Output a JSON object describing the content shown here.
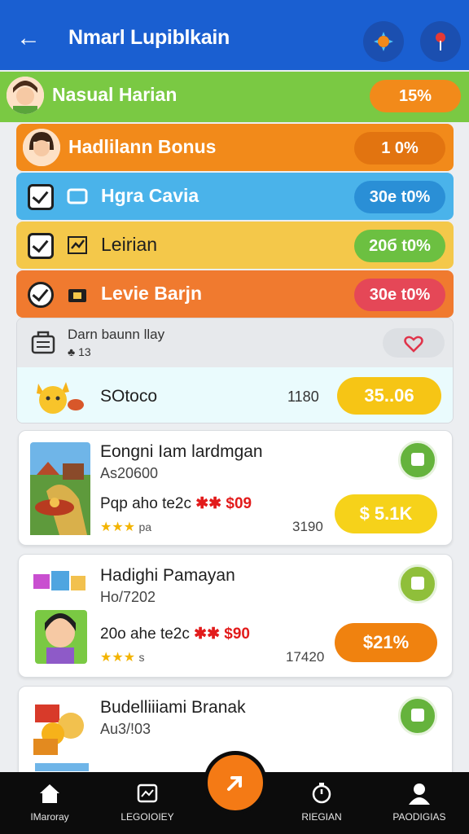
{
  "header": {
    "title": "Nmarl Lupiblkain",
    "back_icon": "arrow-left-icon"
  },
  "status_rows": [
    {
      "label": "Nasual Harian",
      "pill": "15%",
      "bg": "#7ac943",
      "pill_bg": "#f28a1a"
    },
    {
      "label": "Hadlilann Bonus",
      "pill": "1 0%",
      "bg": "#f28a1a",
      "pill_bg": "#e27410"
    },
    {
      "label": "Hgra Cavia",
      "pill": "30e t0%",
      "bg": "#4ab3ea",
      "pill_bg": "#2a8fd6"
    },
    {
      "label": "Leirian",
      "pill": "20б t0%",
      "bg": "#f4c84a",
      "pill_bg": "#6cc041"
    },
    {
      "label": "Levie Barjn",
      "pill": "30e t0%",
      "bg": "#f07a2f",
      "pill_bg": "#e54757"
    }
  ],
  "cart": {
    "title": "Darn baunn llay",
    "count": "13",
    "item": "SOtoco",
    "number": "1180",
    "pay": "35..06"
  },
  "products": [
    {
      "name": "Eongni Iam lardmgan",
      "code": "As20600",
      "promo": "Pqp aho te2c",
      "promo_price": "$09",
      "stars": "★★★",
      "rating_text": "pa",
      "qty": "3190",
      "price": "$ 5.1K",
      "price_bg": "#f6d21a"
    },
    {
      "name": "Hadighi Pamayan",
      "code": "Ho/7202",
      "promo": "20o ahe te2c",
      "promo_price": "$90",
      "stars": "★★★",
      "rating_text": "s",
      "qty": "17420",
      "price": "$21%",
      "price_bg": "#f0820f"
    },
    {
      "name": "Budelliiiami Branak",
      "code": "Au3/!03",
      "promo": "",
      "promo_price": "",
      "stars": "",
      "rating_text": "",
      "qty": "",
      "price": "",
      "price_bg": "#f6d21a"
    }
  ],
  "tabs": [
    {
      "label": "IMaroray",
      "icon": "home-icon"
    },
    {
      "label": "LEGOIOIEY",
      "icon": "gallery-icon"
    },
    {
      "label": "RIEGIAN",
      "icon": "timer-icon"
    },
    {
      "label": "PAODIGIAS",
      "icon": "profile-icon"
    }
  ]
}
